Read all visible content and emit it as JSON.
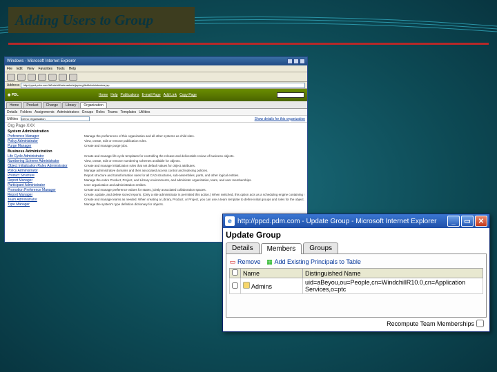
{
  "slide": {
    "title": "Adding Users to Group"
  },
  "back": {
    "title": "Windows - Microsoft Internet Explorer",
    "menu": [
      "File",
      "Edit",
      "View",
      "Favorites",
      "Tools",
      "Help"
    ],
    "toolbar_labels": [
      "Back",
      "Fwd",
      "Stop",
      "Refresh",
      "Home",
      "Search",
      "Favorites"
    ],
    "address_label": "Address",
    "address_value": "http://ppcd.pdm.com/Windchill/netmarkets/jsp/org/listAdministrators.jsp",
    "brand_links": [
      "Home",
      "Help",
      "Publications",
      "E-mail Page",
      "Add Link",
      "Copy Page"
    ],
    "tabs": [
      "Home",
      "Product",
      "Change",
      "Library",
      "Organization"
    ],
    "active_tab": "Organization",
    "sub_tabs": [
      "Details",
      "Folders",
      "Assignments",
      "Administrators",
      "Groups",
      "Roles",
      "Teams",
      "Templates",
      "Utilities"
    ],
    "crumb_label": "Utilities",
    "crumb_input_value": "Demo Organization",
    "crumb_right": "Show details for this organization",
    "page_heading": "Org Page XXX",
    "sections": [
      {
        "heading": "System Administration",
        "rows": [
          {
            "link": "Preference Manager",
            "desc": "Manage the preferences of this organization and all other systems as child sites."
          },
          {
            "link": "Policy Administrator",
            "desc": "View, create, edit or remove publication rules."
          },
          {
            "link": "Purge Manager",
            "desc": "Create and manage purge jobs."
          }
        ]
      },
      {
        "heading": "Business Administration",
        "rows": [
          {
            "link": "Life Cycle Administrator",
            "desc": "Create and manage life cycle templates for controlling the release and deliverable review of business objects."
          },
          {
            "link": "Numbering Scheme Administrator",
            "desc": "View, create, edit or remove numbering schemes available for objects."
          },
          {
            "link": "Object Initialization Rules Administrator",
            "desc": "Create and manage initialization rules that set default values for object attributes."
          },
          {
            "link": "Policy Administrator",
            "desc": "Manage administrative domains and their associated access control and indexing policies."
          },
          {
            "link": "Product Structure",
            "desc": "Report structure and transformation rules for all CAD structures, sub-assemblies, parts, and other logical entities."
          },
          {
            "link": "Report Manager",
            "desc": "Manage the entire Product, Project, and Library environments, and administer organization, team, and user memberships."
          },
          {
            "link": "Participant Administrator",
            "desc": "User organization and administration entities."
          },
          {
            "link": "Promotion Preference Manager",
            "desc": "Create and manage preference values for states, jointly associated collaboration spaces."
          },
          {
            "link": "Report Manager",
            "desc": "Create, update, and delete stored reports. (Only a site administrator is permitted this action.) When switched, this option acts as a scheduling engine containing schedules and historical report information."
          },
          {
            "link": "Team Administrator",
            "desc": "Create and manage teams as needed. When creating a Library, Product, or Project, you can use a team template to define initial groups and roles for the object."
          },
          {
            "link": "Type Manager",
            "desc": "Manage the system's type definition dictionary for objects."
          }
        ]
      }
    ]
  },
  "front": {
    "title": "http://ppcd.pdm.com - Update Group - Microsoft Internet Explorer",
    "heading": "Update Group",
    "tabs": [
      "Details",
      "Members",
      "Groups"
    ],
    "active_tab": "Members",
    "actions": {
      "remove": "Remove",
      "add": "Add Existing Principals to Table"
    },
    "table": {
      "col_cb": "",
      "col_name": "Name",
      "col_dn": "Distinguished Name",
      "rows": [
        {
          "name": "Admins",
          "dn": "uid=aBeyou,ou=People,cn=WindchillR10.0,cn=Application Services,o=ptc"
        }
      ]
    },
    "footer_cb_label": "Recompute Team Memberships"
  }
}
